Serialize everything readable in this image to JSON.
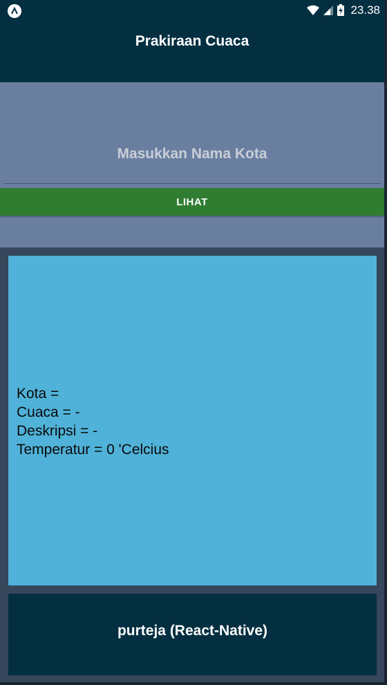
{
  "status_bar": {
    "time": "23.38",
    "icons": [
      "app-badge-icon",
      "wifi-icon",
      "signal-icon",
      "battery-charging-icon"
    ]
  },
  "header": {
    "title": "Prakiraan Cuaca"
  },
  "form": {
    "city_input": {
      "value": "",
      "placeholder": "Masukkan Nama Kota"
    },
    "submit_label": "LIHAT"
  },
  "weather": {
    "city_line": "Kota =",
    "weather_line": "Cuaca = -",
    "description_line": "Deskripsi = -",
    "temperature_line": "Temperatur = 0 'Celcius"
  },
  "footer": {
    "credit": "purteja (React-Native)"
  },
  "colors": {
    "header_bg": "#032f41",
    "form_bg": "#6a7fa0",
    "button_bg": "#307d32",
    "card_bg": "#50b2d8",
    "page_bg": "#36465b"
  }
}
